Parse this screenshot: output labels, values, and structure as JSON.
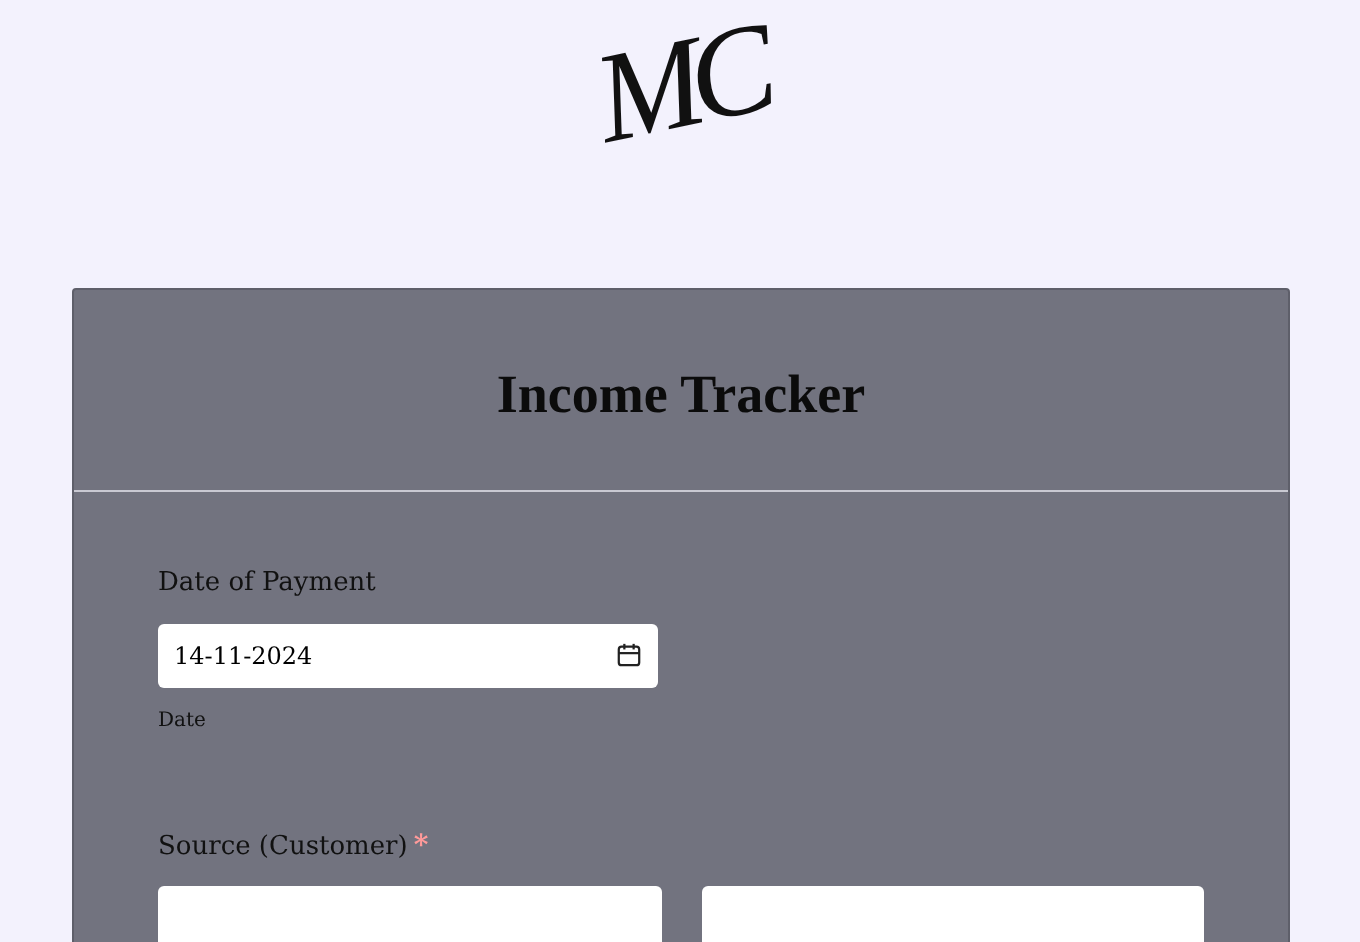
{
  "logo": "MC",
  "form": {
    "title": "Income Tracker",
    "fields": [
      {
        "kind": "date",
        "label": "Date of Payment",
        "required": false,
        "value": "14-11-2024",
        "help": "Date"
      },
      {
        "kind": "pair",
        "label": "Source (Customer)",
        "required": true,
        "required_mark": "*"
      }
    ]
  }
}
